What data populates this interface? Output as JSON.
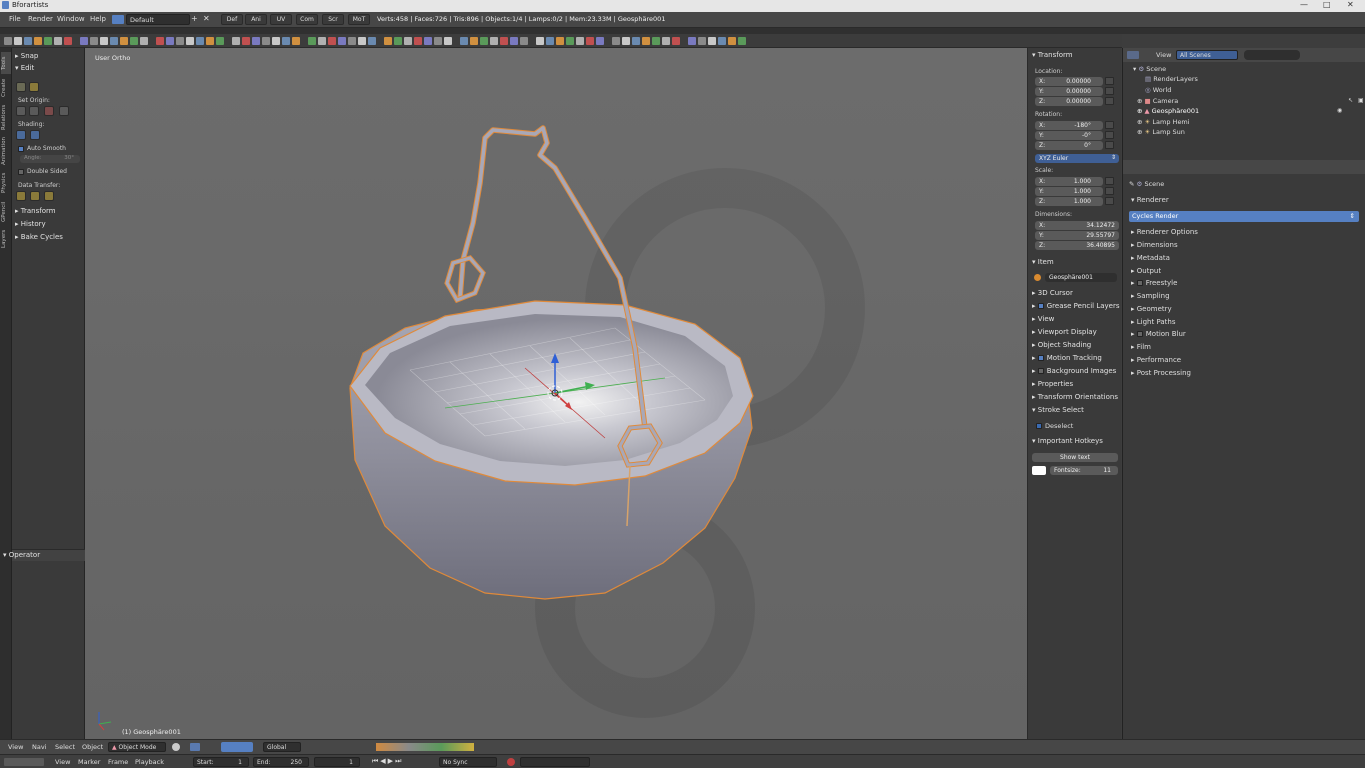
{
  "app": {
    "title": "Bforartists"
  },
  "window_controls": {
    "minimize": "—",
    "maximize": "□",
    "close": "✕"
  },
  "menu": {
    "items": [
      "File",
      "Render",
      "Window",
      "Help"
    ],
    "screen_name": "Default",
    "workspace_tabs": [
      "Def",
      "Ani",
      "UV",
      "Com",
      "Scr",
      "MoT"
    ],
    "stats": "Verts:458 | Faces:726 | Tris:896 | Objects:1/4 | Lamps:0/2 | Mem:23.33M | Geosphäre001"
  },
  "left_tabs": [
    "Tools",
    "Create",
    "Relations",
    "Animation",
    "Physics",
    "GPencil",
    "Layers"
  ],
  "tool_shelf": {
    "snap": "Snap",
    "edit": "Edit",
    "set_origin": "Set Origin:",
    "shading": "Shading:",
    "auto_smooth": "Auto Smooth",
    "angle_label": "Angle:",
    "angle_value": "30°",
    "double_sided": "Double Sided",
    "data_transfer": "Data Transfer:",
    "panels": [
      "Transform",
      "History",
      "Bake Cycles"
    ],
    "operator": "Operator"
  },
  "viewport": {
    "view_label": "User Ortho",
    "active_object": "(1) Geosphäre001"
  },
  "n_panel": {
    "transform": "Transform",
    "location": "Location:",
    "location_values": [
      {
        "axis": "X:",
        "value": "0.00000"
      },
      {
        "axis": "Y:",
        "value": "0.00000"
      },
      {
        "axis": "Z:",
        "value": "0.00000"
      }
    ],
    "rotation": "Rotation:",
    "rotation_values": [
      {
        "axis": "X:",
        "value": "-180°"
      },
      {
        "axis": "Y:",
        "value": "-0°"
      },
      {
        "axis": "Z:",
        "value": "0°"
      }
    ],
    "rotation_mode": "XYZ Euler",
    "scale": "Scale:",
    "scale_values": [
      {
        "axis": "X:",
        "value": "1.000"
      },
      {
        "axis": "Y:",
        "value": "1.000"
      },
      {
        "axis": "Z:",
        "value": "1.000"
      }
    ],
    "dimensions": "Dimensions:",
    "dimension_values": [
      {
        "axis": "X:",
        "value": "34.12472"
      },
      {
        "axis": "Y:",
        "value": "29.55797"
      },
      {
        "axis": "Z:",
        "value": "36.40895"
      }
    ],
    "item": "Item",
    "item_name": "Geosphäre001",
    "sections": [
      "3D Cursor",
      "Grease Pencil Layers",
      "View",
      "Viewport Display",
      "Object Shading",
      "Motion Tracking",
      "Background Images",
      "Properties",
      "Transform Orientations",
      "Stroke Select"
    ],
    "deselect": "Deselect",
    "important_hotkeys": "Important Hotkeys",
    "show_text": "Show text",
    "fontsize_label": "Fontsize:",
    "fontsize_value": "11"
  },
  "outliner": {
    "view": "View",
    "scene_filter": "All Scenes",
    "items": [
      "Scene",
      "RenderLayers",
      "World",
      "Camera",
      "Geosphäre001",
      "Lamp Hemi",
      "Lamp Sun"
    ]
  },
  "properties": {
    "context": "Scene",
    "renderer_header": "Renderer",
    "renderer": "Cycles Render",
    "sections": [
      "Renderer Options",
      "Dimensions",
      "Metadata",
      "Output",
      "Freestyle",
      "Sampling",
      "Geometry",
      "Light Paths",
      "Motion Blur",
      "Film",
      "Performance",
      "Post Processing"
    ]
  },
  "bottom_bar": {
    "menus": [
      "View",
      "Navi",
      "Select",
      "Object"
    ],
    "mode": "Object Mode",
    "orientation": "Global"
  },
  "timeline": {
    "menus": [
      "View",
      "Marker",
      "Frame",
      "Playback"
    ],
    "start_label": "Start:",
    "start": "1",
    "end_label": "End:",
    "end": "250",
    "current": "1",
    "sync": "No Sync"
  }
}
